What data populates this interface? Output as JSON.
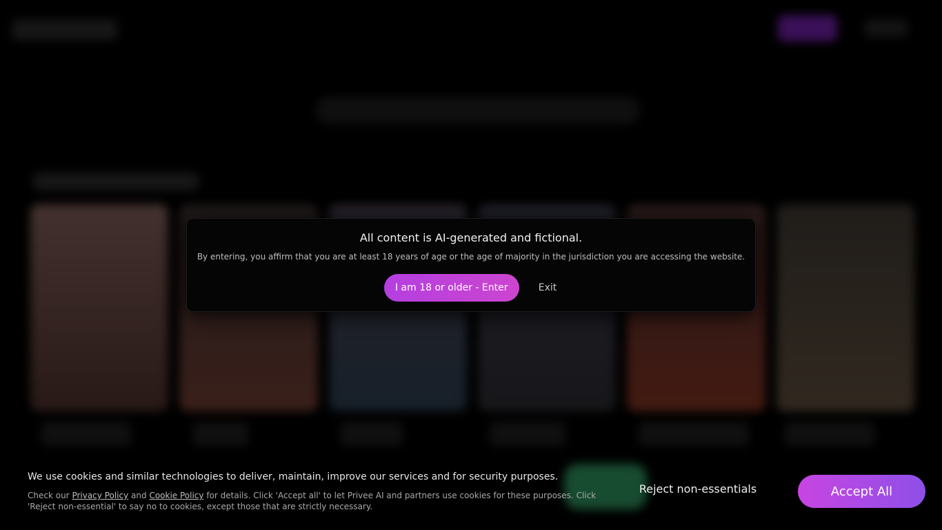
{
  "age_gate": {
    "title": "All content is AI-generated and fictional.",
    "description": "By entering, you affirm that you are at least 18 years of age or the age of majority in the jurisdiction you are accessing the website.",
    "enter_label": "I am 18 or older - Enter",
    "exit_label": "Exit"
  },
  "cookie_banner": {
    "message": "We use cookies and similar technologies to deliver, maintain, improve our services and for security purposes.",
    "detail_prefix": "Check our ",
    "privacy_link": "Privacy Policy",
    "detail_and": " and ",
    "cookie_link": "Cookie Policy",
    "detail_suffix": " for details. Click 'Accept all' to let Privee AI and partners use cookies for these purposes. Click 'Reject non-essential' to say no to cookies, except those that are strictly necessary.",
    "reject_label": "Reject non-essentials",
    "accept_label": "Accept All"
  },
  "colors": {
    "accent": "#c845e2",
    "accent_end": "#8e4fe8",
    "background": "#000000"
  }
}
